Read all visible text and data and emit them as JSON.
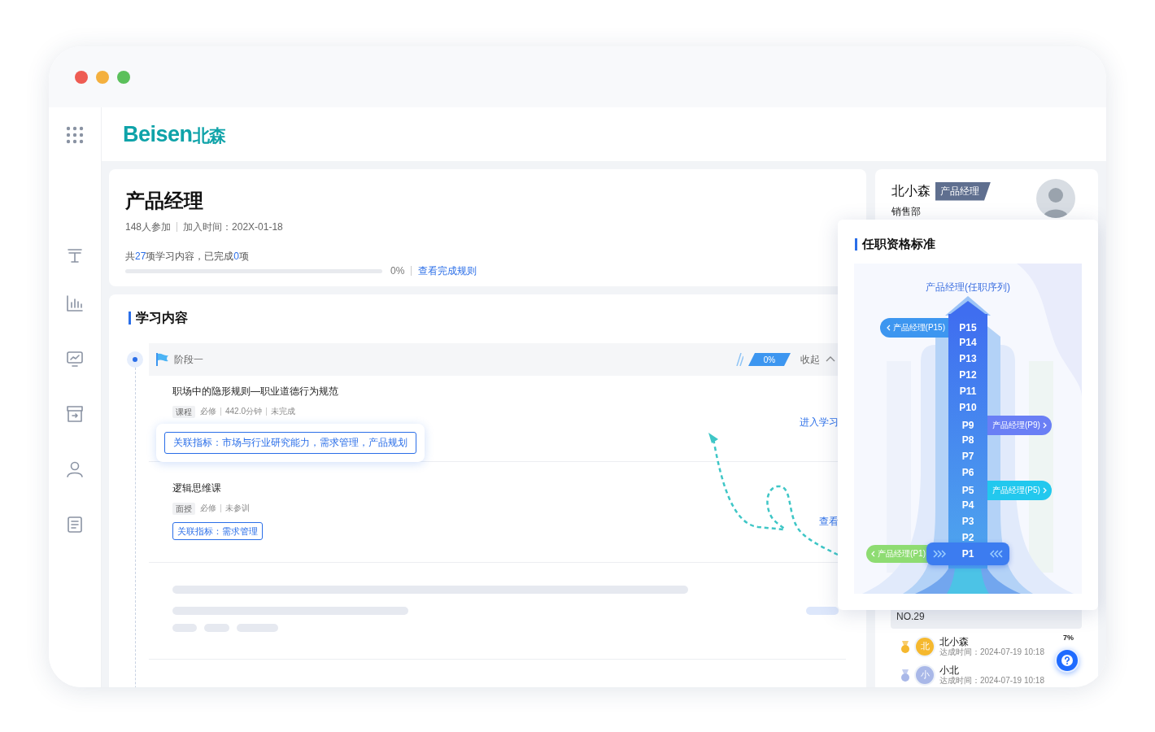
{
  "logo": {
    "latin": "Beisen",
    "chinese": "北森"
  },
  "course": {
    "title": "产品经理",
    "participants": "148人参加",
    "joined": "加入时间：202X-01-18",
    "summary": "共**27**项学习内容，已完成**0**项",
    "progress": {
      "level": 0,
      "reading": "0%"
    },
    "rules_link": "查看完成规则"
  },
  "study": {
    "title": "学习内容",
    "stage": {
      "name": "阶段一",
      "progress": "0%",
      "toggle": "收起",
      "expanded": true
    },
    "items": [
      {
        "kind": "course",
        "title": "职场中的隐形规则—职业道德行为规范",
        "type": "课程",
        "meta": [
          "必修",
          "442.0分钟",
          "未完成"
        ],
        "indicators": "关联指标：市场与行业研究能力，需求管理，产品规划",
        "highlighted": true,
        "action": "进入学习"
      },
      {
        "kind": "course",
        "title": "逻辑思维课",
        "type": "面授",
        "meta": [
          "必修",
          "未参训"
        ],
        "indicators": "关联指标：需求管理",
        "highlighted": false,
        "action": "查看"
      },
      {
        "kind": "skeleton"
      }
    ]
  },
  "profile": {
    "name": "北小森",
    "role": "产品经理",
    "department": "销售部"
  },
  "ranking": {
    "my_rank": "NO.29",
    "rows": [
      {
        "avatar": "北",
        "name": "北小森",
        "time": "达成时间：2024-07-19 10:18",
        "percent": "7%",
        "color": "#f5b82e"
      },
      {
        "avatar": "小",
        "name": "小北",
        "time": "达成时间：2024-07-19 10:18",
        "color": "#a9b8e8"
      }
    ]
  },
  "qualification": {
    "title": "任职资格标准",
    "ladder_title": "产品经理(任职序列)",
    "levels": [
      {
        "label": "P15",
        "tag": {
          "text": "产品经理(P15)",
          "kind": "left",
          "color": "#3d96f0"
        }
      },
      {
        "label": "P14"
      },
      {
        "label": "P13"
      },
      {
        "label": "P12"
      },
      {
        "label": "P11"
      },
      {
        "label": "P10"
      },
      {
        "label": "P9",
        "tag": {
          "text": "产品经理(P9)",
          "kind": "right",
          "color": "#6a7ff5"
        }
      },
      {
        "label": "P8"
      },
      {
        "label": "P7"
      },
      {
        "label": "P6"
      },
      {
        "label": "P5",
        "tag": {
          "text": "产品经理(P5)",
          "kind": "right",
          "color": "#22c8ee"
        }
      },
      {
        "label": "P4"
      },
      {
        "label": "P3"
      },
      {
        "label": "P2"
      },
      {
        "label": "P1",
        "kind": "base",
        "tag": {
          "text": "产品经理(P1)",
          "kind": "left",
          "color": "#8edc72"
        }
      }
    ]
  }
}
